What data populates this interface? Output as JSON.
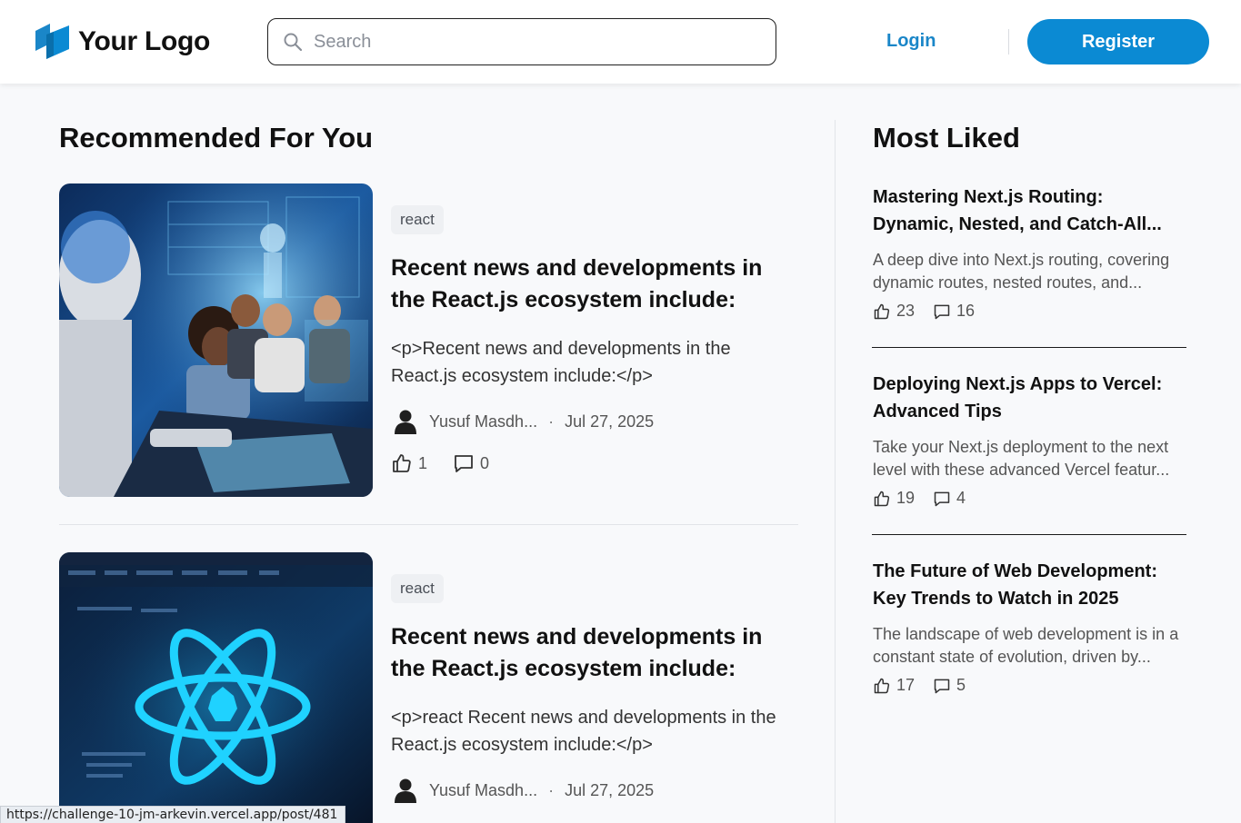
{
  "header": {
    "logo_text": "Your Logo",
    "search_placeholder": "Search",
    "login_label": "Login",
    "register_label": "Register"
  },
  "recommended": {
    "title": "Recommended For You",
    "posts": [
      {
        "tag": "react",
        "title": "Recent news and developments in the React.js ecosystem include:",
        "excerpt": "<p>Recent news and developments in the React.js ecosystem include:</p>",
        "author": "Yusuf Masdh...",
        "date": "Jul 27, 2025",
        "likes": "1",
        "comments": "0"
      },
      {
        "tag": "react",
        "title": "Recent news and developments in the React.js ecosystem include:",
        "excerpt": "<p>react Recent news and developments in the React.js ecosystem include:</p>",
        "author": "Yusuf Masdh...",
        "date": "Jul 27, 2025"
      }
    ]
  },
  "most_liked": {
    "title": "Most Liked",
    "posts": [
      {
        "title": "Mastering Next.js Routing: Dynamic, Nested, and Catch-All...",
        "excerpt": "A deep dive into Next.js routing, covering dynamic routes, nested routes, and...",
        "likes": "23",
        "comments": "16"
      },
      {
        "title": "Deploying Next.js Apps to Vercel: Advanced Tips",
        "excerpt": "Take your Next.js deployment to the next level with these advanced Vercel featur...",
        "likes": "19",
        "comments": "4"
      },
      {
        "title": "The Future of Web Development: Key Trends to Watch in 2025",
        "excerpt": "The landscape of web development is in a constant state of evolution, driven by...",
        "likes": "17",
        "comments": "5"
      }
    ]
  },
  "status_bar": {
    "url": "https://challenge-10-jm-arkevin.vercel.app/post/481"
  },
  "icons": {
    "logo": "logo-cube-icon",
    "search": "search-icon",
    "author": "user-avatar-icon",
    "like": "thumbs-up-icon",
    "comment": "comment-bubble-icon"
  },
  "colors": {
    "brand_blue": "#0b8ad3",
    "login_blue": "#1a86c8",
    "page_bg": "#f8f9fb"
  }
}
